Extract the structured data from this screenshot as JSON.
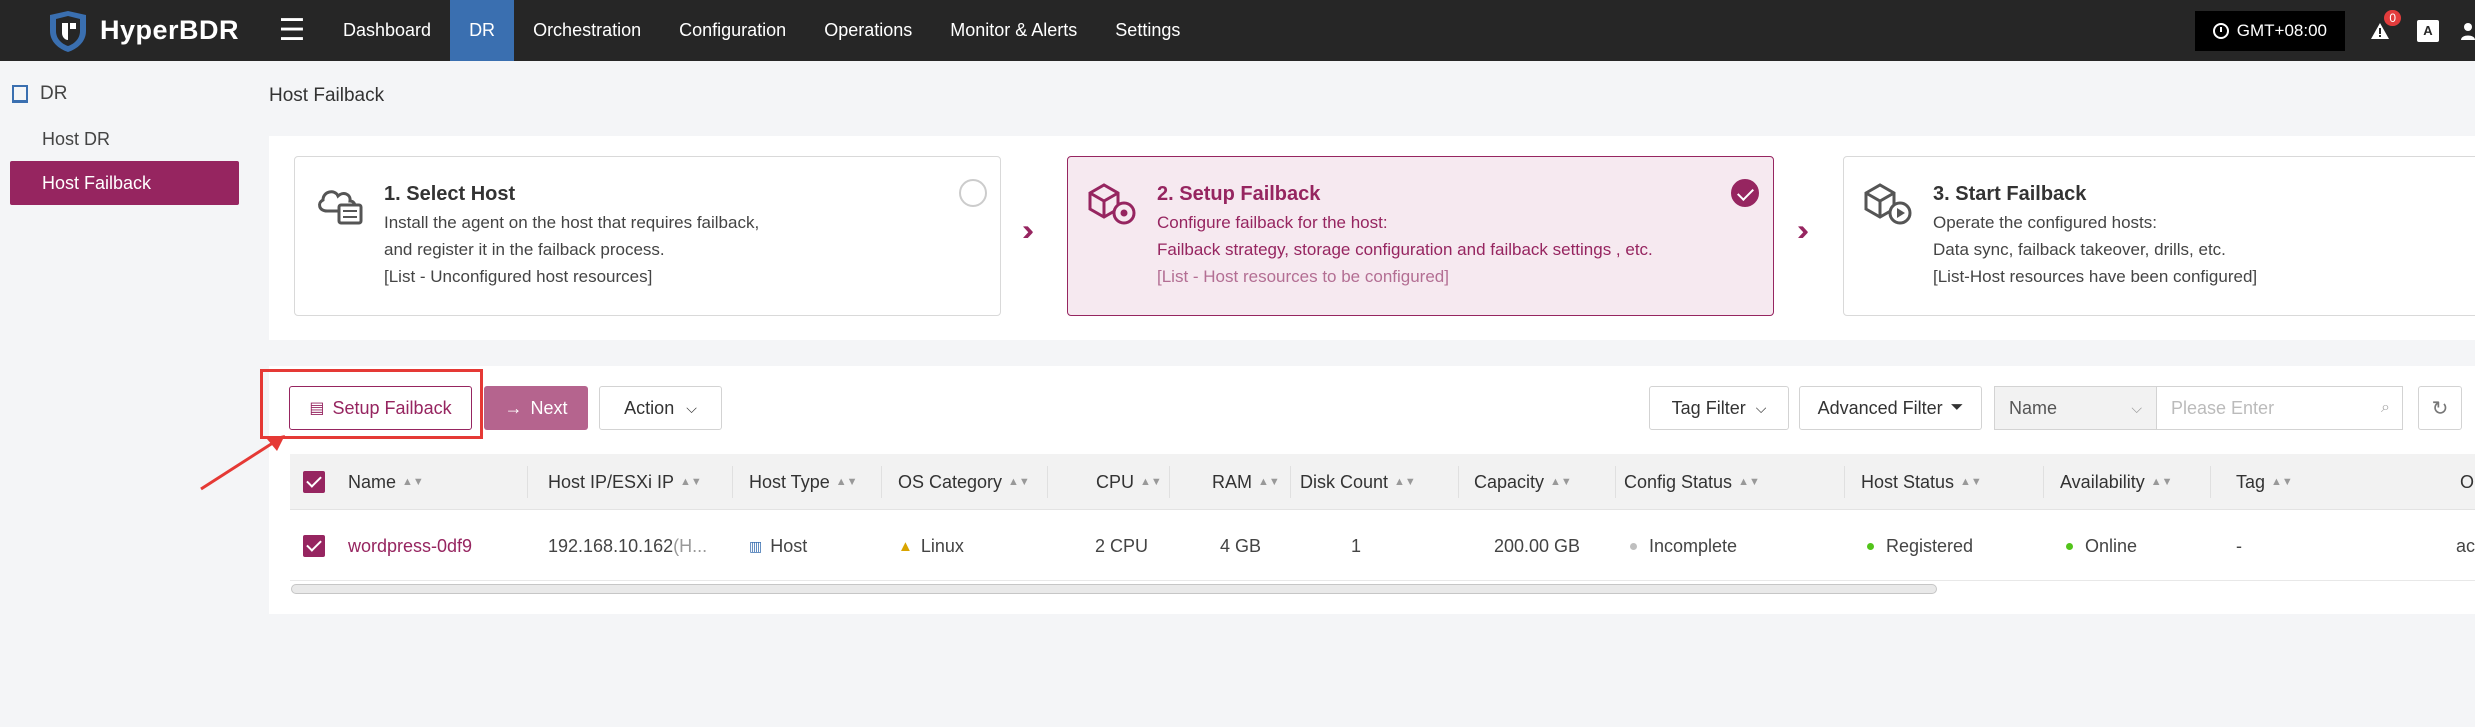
{
  "app": {
    "name": "HyperBDR"
  },
  "nav": {
    "items": [
      "Dashboard",
      "DR",
      "Orchestration",
      "Configuration",
      "Operations",
      "Monitor & Alerts",
      "Settings"
    ],
    "active_index": 1
  },
  "topbar": {
    "timezone": "GMT+08:00",
    "alert_count": "0",
    "translate_label": "A"
  },
  "sidebar": {
    "section": "DR",
    "items": [
      {
        "label": "Host DR",
        "active": false
      },
      {
        "label": "Host Failback",
        "active": true
      }
    ]
  },
  "page": {
    "title": "Host Failback"
  },
  "steps": [
    {
      "title": "1. Select Host",
      "lines": [
        "Install the agent on the host that requires failback,",
        "and register it in the failback process.",
        "[List - Unconfigured host resources]"
      ],
      "checked": false
    },
    {
      "title": "2. Setup Failback",
      "lines": [
        "Configure failback for the host:",
        "Failback strategy, storage configuration and failback settings , etc.",
        "[List - Host resources to be configured]"
      ],
      "checked": true
    },
    {
      "title": "3. Start Failback",
      "lines": [
        "Operate the configured hosts:",
        "Data sync, failback takeover, drills, etc.",
        "[List-Host resources have been configured]"
      ],
      "checked": false
    }
  ],
  "toolbar": {
    "setup_failback": "Setup Failback",
    "next": "Next",
    "action": "Action",
    "tag_filter": "Tag Filter",
    "advanced_filter": "Advanced Filter",
    "search_field": "Name",
    "search_placeholder": "Please Enter"
  },
  "table": {
    "columns": [
      "Name",
      "Host IP/ESXi IP",
      "Host Type",
      "OS Category",
      "CPU",
      "RAM",
      "Disk Count",
      "Capacity",
      "Config Status",
      "Host Status",
      "Availability",
      "Tag",
      "O"
    ],
    "rows": [
      {
        "name": "wordpress-0df9",
        "ip": "192.168.10.162",
        "ip_suffix": "(H...",
        "host_type": "Host",
        "os": "Linux",
        "cpu": "2 CPU",
        "ram": "4 GB",
        "disk_count": "1",
        "capacity": "200.00 GB",
        "config_status": "Incomplete",
        "host_status": "Registered",
        "availability": "Online",
        "tag": "-",
        "op": "ac"
      }
    ]
  },
  "colors": {
    "brand": "#962560",
    "nav_active": "#3a6fb0",
    "success": "#52c41a",
    "neutral": "#bfbfbf",
    "highlight": "#e53935"
  }
}
